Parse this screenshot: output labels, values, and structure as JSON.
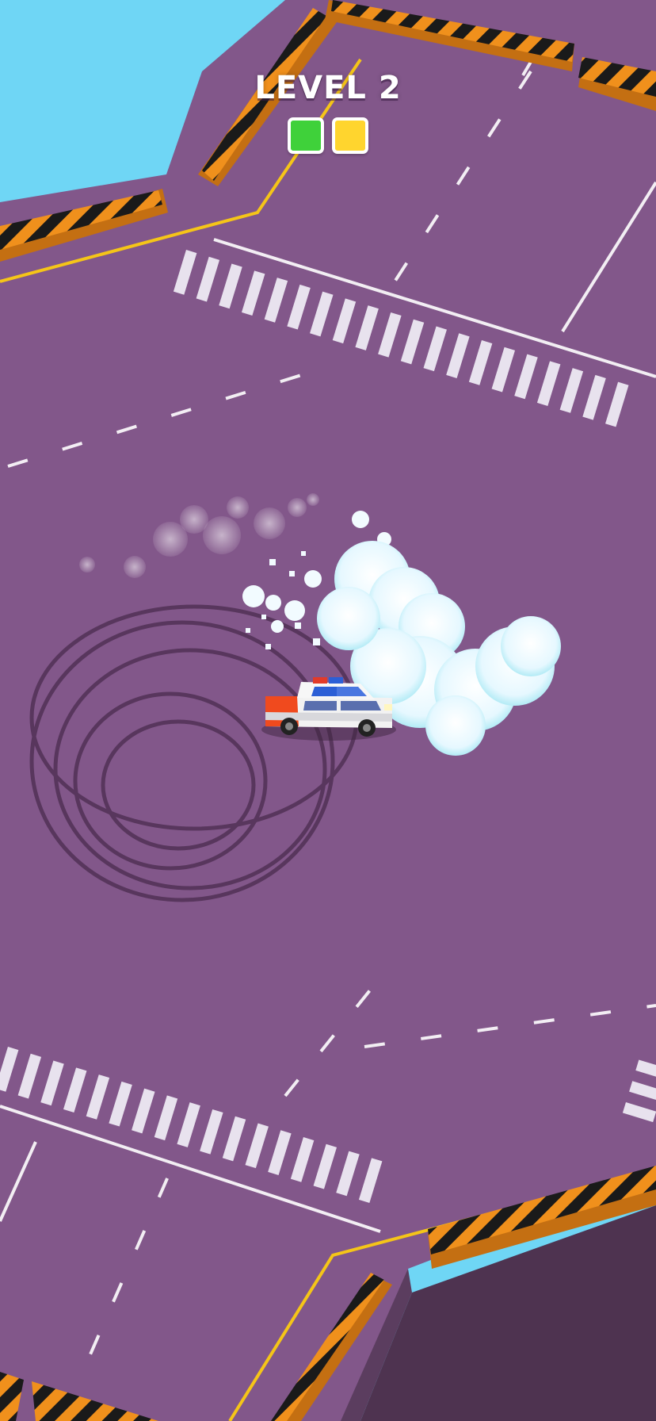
{
  "hud": {
    "level_label": "LEVEL 2",
    "progress": [
      {
        "state": "complete",
        "color": "#3fd13a"
      },
      {
        "state": "current",
        "color": "#ffd52e"
      }
    ]
  },
  "scene": {
    "sky_color": "#6fd6f5",
    "road_color": "#82578a",
    "road_side_color": "#4e3350",
    "barrier_colors": [
      "#f0901c",
      "#1a1a1a"
    ],
    "edge_line_color": "#f5c518",
    "car_colors": {
      "body": "#f2f2f2",
      "stripe": "#f04a1e",
      "light": "#2c5fd6"
    },
    "smoke_color": "#eafaff"
  }
}
